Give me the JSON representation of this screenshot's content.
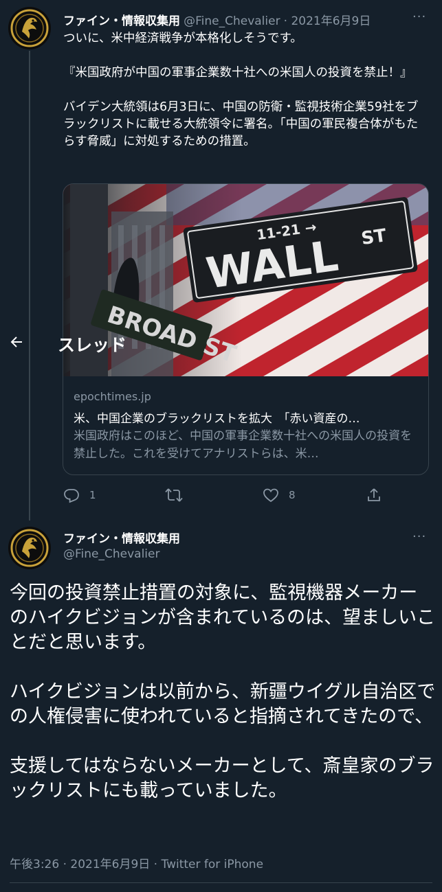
{
  "thread_header": {
    "title": "スレッド"
  },
  "tweet1": {
    "author_name": "ファイン・情報収集用",
    "handle": "@Fine_Chevalier",
    "date": "· 2021年6月9日",
    "more": "···",
    "text": "ついに、米中経済戦争が本格化しそうです。\n\n『米国政府が中国の軍事企業数十社への米国人の投資を禁止！』\n\nバイデン大統領は6月3日に、中国の防衛・監視技術企業59社をブラックリストに載せる大統領令に署名。「中国の軍民複合体がもたらす脅威」に対処するための措置。",
    "card": {
      "image_sign_main": "WALL",
      "image_sign_sup": "ST",
      "image_sign_top": "11-21 →",
      "image_sign_lower": "BROAD ST",
      "domain": "epochtimes.jp",
      "title": "米、中国企業のブラックリストを拡大　「赤い資産の…",
      "description": "米国政府はこのほど、中国の軍事企業数十社への米国人の投資を禁止した。これを受けてアナリストらは、米…"
    },
    "actions": {
      "reply_count": "1",
      "retweet_count": "",
      "like_count": "8"
    }
  },
  "tweet2": {
    "author_name": "ファイン・情報収集用",
    "handle": "@Fine_Chevalier",
    "more": "···",
    "text": "今回の投資禁止措置の対象に、監視機器メーカーのハイクビジョンが含まれているのは、望ましいことだと思います。\n\nハイクビジョンは以前から、新疆ウイグル自治区での人権侵害に使われていると指摘されてきたので、\n\n支援してはならないメーカーとして、斎皇家のブラックリストにも載っていました。",
    "meta": "午後3:26 · 2021年6月9日 · Twitter for iPhone"
  },
  "colors": {
    "background": "#15202b",
    "secondary_text": "#8b98a5",
    "border": "#38444d",
    "avatar_gold": "#c9a23a"
  },
  "icons": [
    "back-arrow-icon",
    "reply-icon",
    "retweet-icon",
    "like-icon",
    "share-icon",
    "more-icon"
  ]
}
